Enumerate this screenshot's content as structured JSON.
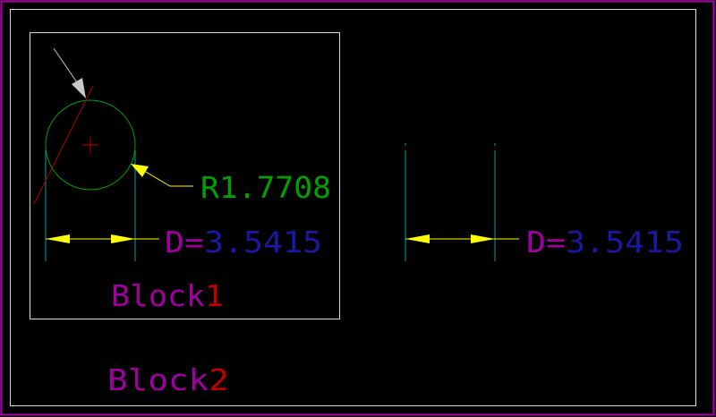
{
  "drawing": {
    "radius_label": "R1.7708",
    "dimension_left": {
      "prefix": "D=",
      "value": "3.5415"
    },
    "dimension_right": {
      "prefix": "D=",
      "value": "3.5415"
    },
    "block1_label": {
      "text": "Block",
      "number": "1"
    },
    "block2_label": {
      "text": "Block",
      "number": "2"
    }
  },
  "colors": {
    "background": "#000000",
    "frame_outer": "#b000b0",
    "frame_inner": "#d8d8d8",
    "block_border": "#d8d8d8",
    "circle": "#00a000",
    "center_mark": "#c00000",
    "tangent_line": "#b00000",
    "extension_line": "#00a0a0",
    "dimension_arrow": "#ffff00",
    "leader_arrow": "#c8c8c8",
    "radius_text": "#00a000",
    "dim_prefix": "#a000a0",
    "dim_value": "#1a1aa0",
    "block_text": "#a000a0",
    "block_number": "#c00000"
  }
}
